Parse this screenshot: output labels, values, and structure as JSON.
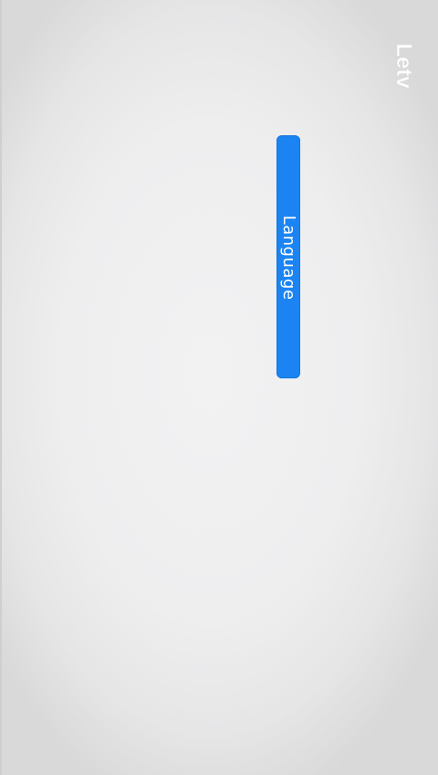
{
  "brand": {
    "logo_text": "Letv",
    "logo_color": "#ffffff"
  },
  "language_button": {
    "label": "Language",
    "color": "#1b84f2"
  },
  "background": {
    "color": "#eeeeef"
  }
}
